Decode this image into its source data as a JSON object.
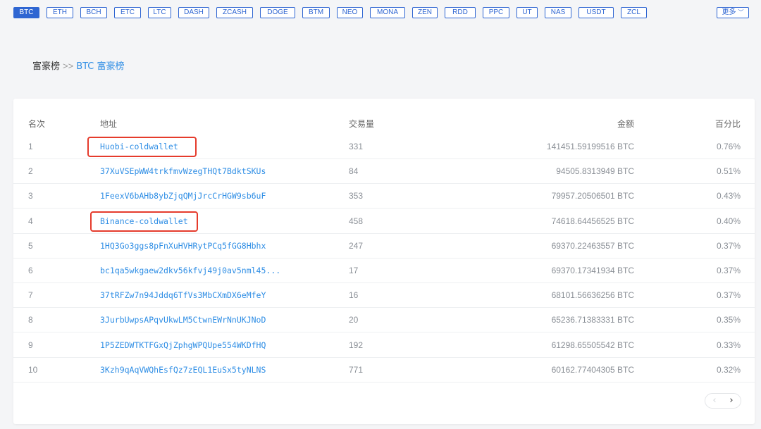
{
  "coins": [
    {
      "label": "BTC",
      "active": true
    },
    {
      "label": "ETH"
    },
    {
      "label": "BCH"
    },
    {
      "label": "ETC"
    },
    {
      "label": "LTC"
    },
    {
      "label": "DASH"
    },
    {
      "label": "ZCASH"
    },
    {
      "label": "DOGE"
    },
    {
      "label": "BTM"
    },
    {
      "label": "NEO"
    },
    {
      "label": "MONA"
    },
    {
      "label": "ZEN"
    },
    {
      "label": "RDD"
    },
    {
      "label": "PPC"
    },
    {
      "label": "UT"
    },
    {
      "label": "NAS"
    },
    {
      "label": "USDT"
    },
    {
      "label": "ZCL"
    }
  ],
  "more": {
    "label": "更多"
  },
  "breadcrumb": {
    "root": "富豪榜",
    "separator": ">>",
    "current": "BTC 富豪榜"
  },
  "table": {
    "headers": {
      "rank": "名次",
      "address": "地址",
      "tx": "交易量",
      "amount": "金额",
      "percent": "百分比"
    },
    "rows": [
      {
        "rank": "1",
        "address": "Huobi-coldwallet",
        "tx": "331",
        "amount": "141451.59199516 BTC",
        "percent": "0.76%",
        "highlighted": true
      },
      {
        "rank": "2",
        "address": "37XuVSEpWW4trkfmvWzegTHQt7BdktSKUs",
        "tx": "84",
        "amount": "94505.8313949 BTC",
        "percent": "0.51%"
      },
      {
        "rank": "3",
        "address": "1FeexV6bAHb8ybZjqQMjJrcCrHGW9sb6uF",
        "tx": "353",
        "amount": "79957.20506501 BTC",
        "percent": "0.43%"
      },
      {
        "rank": "4",
        "address": "Binance-coldwallet",
        "tx": "458",
        "amount": "74618.64456525 BTC",
        "percent": "0.40%",
        "highlighted": true
      },
      {
        "rank": "5",
        "address": "1HQ3Go3ggs8pFnXuHVHRytPCq5fGG8Hbhx",
        "tx": "247",
        "amount": "69370.22463557 BTC",
        "percent": "0.37%"
      },
      {
        "rank": "6",
        "address": "bc1qa5wkgaew2dkv56kfvj49j0av5nml45...",
        "tx": "17",
        "amount": "69370.17341934 BTC",
        "percent": "0.37%"
      },
      {
        "rank": "7",
        "address": "37tRFZw7n94Jddq6TfVs3MbCXmDX6eMfeY",
        "tx": "16",
        "amount": "68101.56636256 BTC",
        "percent": "0.37%"
      },
      {
        "rank": "8",
        "address": "3JurbUwpsAPqvUkwLM5CtwnEWrNnUKJNoD",
        "tx": "20",
        "amount": "65236.71383331 BTC",
        "percent": "0.35%"
      },
      {
        "rank": "9",
        "address": "1P5ZEDWTKTFGxQjZphgWPQUpe554WKDfHQ",
        "tx": "192",
        "amount": "61298.65505542 BTC",
        "percent": "0.33%"
      },
      {
        "rank": "10",
        "address": "3Kzh9qAqVWQhEsfQz7zEQL1EuSx5tyNLNS",
        "tx": "771",
        "amount": "60162.77404305 BTC",
        "percent": "0.32%"
      }
    ]
  },
  "pager": {
    "prev": "‹",
    "next": "›"
  },
  "colors": {
    "accent": "#2f66d2",
    "link": "#2f8ee5",
    "highlight": "#e53b2c"
  }
}
